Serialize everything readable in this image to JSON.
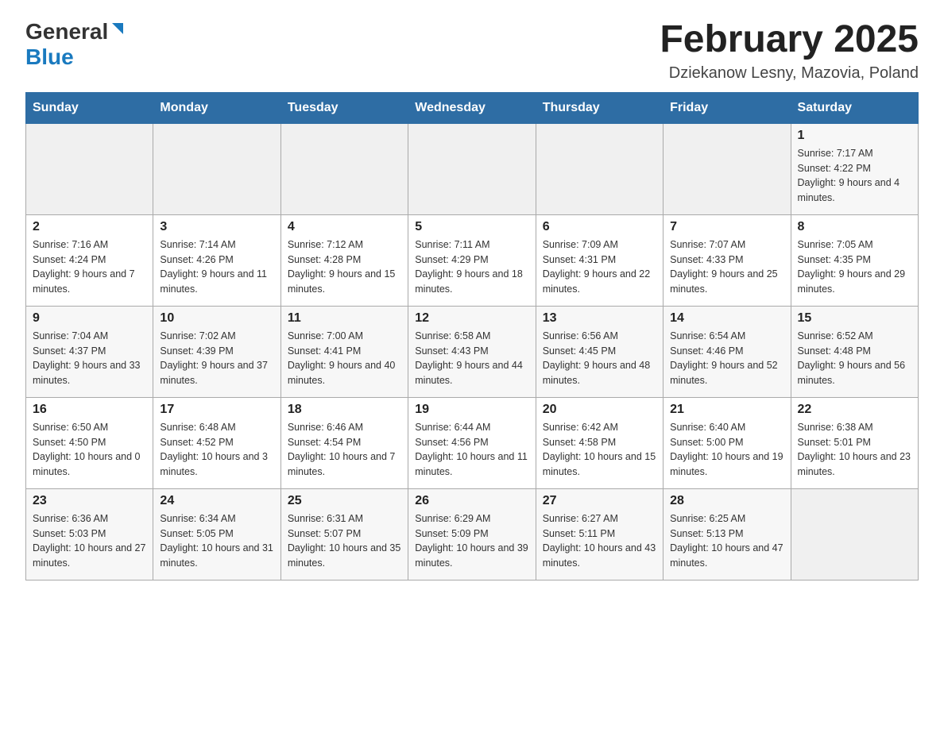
{
  "header": {
    "logo_general": "General",
    "logo_blue": "Blue",
    "title": "February 2025",
    "location": "Dziekanow Lesny, Mazovia, Poland"
  },
  "weekdays": [
    "Sunday",
    "Monday",
    "Tuesday",
    "Wednesday",
    "Thursday",
    "Friday",
    "Saturday"
  ],
  "weeks": [
    [
      {
        "day": "",
        "info": ""
      },
      {
        "day": "",
        "info": ""
      },
      {
        "day": "",
        "info": ""
      },
      {
        "day": "",
        "info": ""
      },
      {
        "day": "",
        "info": ""
      },
      {
        "day": "",
        "info": ""
      },
      {
        "day": "1",
        "info": "Sunrise: 7:17 AM\nSunset: 4:22 PM\nDaylight: 9 hours and 4 minutes."
      }
    ],
    [
      {
        "day": "2",
        "info": "Sunrise: 7:16 AM\nSunset: 4:24 PM\nDaylight: 9 hours and 7 minutes."
      },
      {
        "day": "3",
        "info": "Sunrise: 7:14 AM\nSunset: 4:26 PM\nDaylight: 9 hours and 11 minutes."
      },
      {
        "day": "4",
        "info": "Sunrise: 7:12 AM\nSunset: 4:28 PM\nDaylight: 9 hours and 15 minutes."
      },
      {
        "day": "5",
        "info": "Sunrise: 7:11 AM\nSunset: 4:29 PM\nDaylight: 9 hours and 18 minutes."
      },
      {
        "day": "6",
        "info": "Sunrise: 7:09 AM\nSunset: 4:31 PM\nDaylight: 9 hours and 22 minutes."
      },
      {
        "day": "7",
        "info": "Sunrise: 7:07 AM\nSunset: 4:33 PM\nDaylight: 9 hours and 25 minutes."
      },
      {
        "day": "8",
        "info": "Sunrise: 7:05 AM\nSunset: 4:35 PM\nDaylight: 9 hours and 29 minutes."
      }
    ],
    [
      {
        "day": "9",
        "info": "Sunrise: 7:04 AM\nSunset: 4:37 PM\nDaylight: 9 hours and 33 minutes."
      },
      {
        "day": "10",
        "info": "Sunrise: 7:02 AM\nSunset: 4:39 PM\nDaylight: 9 hours and 37 minutes."
      },
      {
        "day": "11",
        "info": "Sunrise: 7:00 AM\nSunset: 4:41 PM\nDaylight: 9 hours and 40 minutes."
      },
      {
        "day": "12",
        "info": "Sunrise: 6:58 AM\nSunset: 4:43 PM\nDaylight: 9 hours and 44 minutes."
      },
      {
        "day": "13",
        "info": "Sunrise: 6:56 AM\nSunset: 4:45 PM\nDaylight: 9 hours and 48 minutes."
      },
      {
        "day": "14",
        "info": "Sunrise: 6:54 AM\nSunset: 4:46 PM\nDaylight: 9 hours and 52 minutes."
      },
      {
        "day": "15",
        "info": "Sunrise: 6:52 AM\nSunset: 4:48 PM\nDaylight: 9 hours and 56 minutes."
      }
    ],
    [
      {
        "day": "16",
        "info": "Sunrise: 6:50 AM\nSunset: 4:50 PM\nDaylight: 10 hours and 0 minutes."
      },
      {
        "day": "17",
        "info": "Sunrise: 6:48 AM\nSunset: 4:52 PM\nDaylight: 10 hours and 3 minutes."
      },
      {
        "day": "18",
        "info": "Sunrise: 6:46 AM\nSunset: 4:54 PM\nDaylight: 10 hours and 7 minutes."
      },
      {
        "day": "19",
        "info": "Sunrise: 6:44 AM\nSunset: 4:56 PM\nDaylight: 10 hours and 11 minutes."
      },
      {
        "day": "20",
        "info": "Sunrise: 6:42 AM\nSunset: 4:58 PM\nDaylight: 10 hours and 15 minutes."
      },
      {
        "day": "21",
        "info": "Sunrise: 6:40 AM\nSunset: 5:00 PM\nDaylight: 10 hours and 19 minutes."
      },
      {
        "day": "22",
        "info": "Sunrise: 6:38 AM\nSunset: 5:01 PM\nDaylight: 10 hours and 23 minutes."
      }
    ],
    [
      {
        "day": "23",
        "info": "Sunrise: 6:36 AM\nSunset: 5:03 PM\nDaylight: 10 hours and 27 minutes."
      },
      {
        "day": "24",
        "info": "Sunrise: 6:34 AM\nSunset: 5:05 PM\nDaylight: 10 hours and 31 minutes."
      },
      {
        "day": "25",
        "info": "Sunrise: 6:31 AM\nSunset: 5:07 PM\nDaylight: 10 hours and 35 minutes."
      },
      {
        "day": "26",
        "info": "Sunrise: 6:29 AM\nSunset: 5:09 PM\nDaylight: 10 hours and 39 minutes."
      },
      {
        "day": "27",
        "info": "Sunrise: 6:27 AM\nSunset: 5:11 PM\nDaylight: 10 hours and 43 minutes."
      },
      {
        "day": "28",
        "info": "Sunrise: 6:25 AM\nSunset: 5:13 PM\nDaylight: 10 hours and 47 minutes."
      },
      {
        "day": "",
        "info": ""
      }
    ]
  ]
}
